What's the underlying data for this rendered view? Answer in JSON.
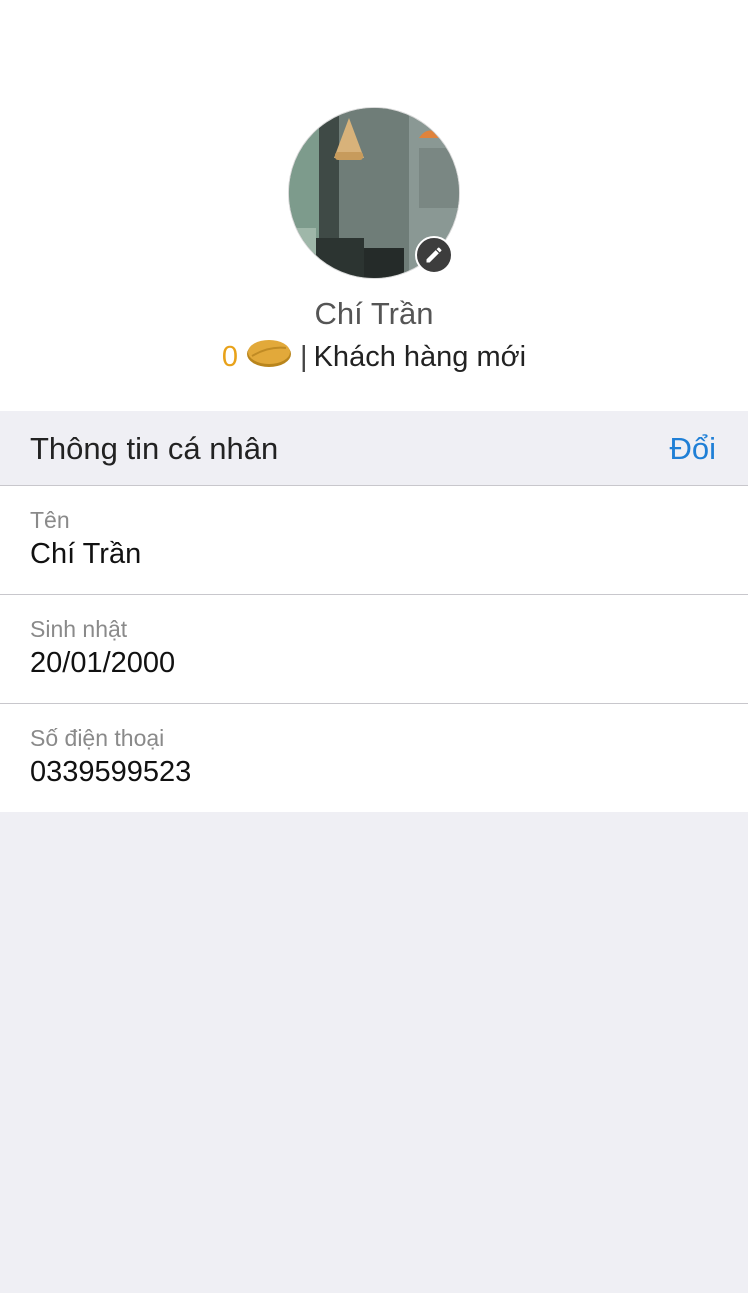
{
  "profile": {
    "name": "Chí Trần",
    "points": "0",
    "separator": "|",
    "membership": "Khách hàng mới"
  },
  "icons": {
    "avatar": "cafe-photo-avatar",
    "edit": "pencil-icon",
    "coin": "coin-icon"
  },
  "colors": {
    "accent": "#1f7fd6",
    "points": "#e8a21a",
    "background": "#efeff4"
  },
  "section": {
    "title": "Thông tin cá nhân",
    "action_label": "Đổi"
  },
  "fields": [
    {
      "label": "Tên",
      "value": "Chí Trần"
    },
    {
      "label": "Sinh nhật",
      "value": "20/01/2000"
    },
    {
      "label": "Số điện thoại",
      "value": "0339599523"
    }
  ]
}
